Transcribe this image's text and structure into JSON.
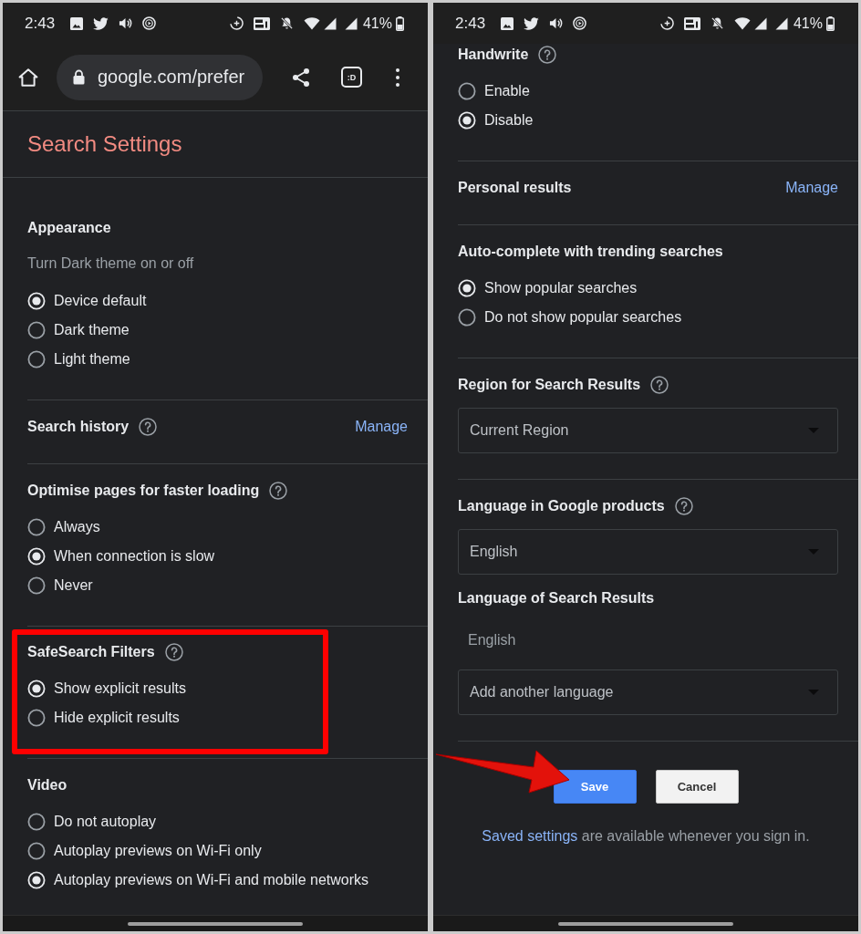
{
  "panels": [
    {
      "status_bar": {
        "time": "2:43",
        "battery": "41%"
      },
      "toolbar": {
        "url": "google.com/prefer",
        "tab_switcher": ":D"
      },
      "title": "Search Settings",
      "sections": [
        {
          "highlighted": false,
          "rows": [
            {
              "kind": "heading",
              "text": "Appearance",
              "help": false
            },
            {
              "kind": "note",
              "text": "Turn Dark theme on or off"
            },
            {
              "kind": "radio",
              "label": "Device default",
              "selected": true
            },
            {
              "kind": "radio",
              "label": "Dark theme",
              "selected": false
            },
            {
              "kind": "radio",
              "label": "Light theme",
              "selected": false
            }
          ]
        },
        {
          "highlighted": false,
          "rows": [
            {
              "kind": "heading",
              "text": "Search history",
              "help": true,
              "link": "Manage"
            }
          ]
        },
        {
          "highlighted": false,
          "rows": [
            {
              "kind": "heading",
              "text": "Optimise pages for faster loading",
              "help": true
            },
            {
              "kind": "radio",
              "label": "Always",
              "selected": false
            },
            {
              "kind": "radio",
              "label": "When connection is slow",
              "selected": true
            },
            {
              "kind": "radio",
              "label": "Never",
              "selected": false
            }
          ]
        },
        {
          "highlighted": true,
          "rows": [
            {
              "kind": "heading",
              "text": "SafeSearch Filters",
              "help": true
            },
            {
              "kind": "radio",
              "label": "Show explicit results",
              "selected": true
            },
            {
              "kind": "radio",
              "label": "Hide explicit results",
              "selected": false
            }
          ]
        },
        {
          "highlighted": false,
          "rows": [
            {
              "kind": "heading",
              "text": "Video",
              "help": false
            },
            {
              "kind": "radio",
              "label": "Do not autoplay",
              "selected": false
            },
            {
              "kind": "radio",
              "label": "Autoplay previews on Wi-Fi only",
              "selected": false
            },
            {
              "kind": "radio",
              "label": "Autoplay previews on Wi-Fi and mobile networks",
              "selected": true
            }
          ]
        }
      ]
    },
    {
      "status_bar": {
        "time": "2:43",
        "battery": "41%"
      },
      "sections": [
        {
          "highlighted": false,
          "rows": [
            {
              "kind": "heading",
              "text": "Handwrite",
              "help": true
            },
            {
              "kind": "radio",
              "label": "Enable",
              "selected": false
            },
            {
              "kind": "radio",
              "label": "Disable",
              "selected": true
            }
          ]
        },
        {
          "highlighted": false,
          "rows": [
            {
              "kind": "heading",
              "text": "Personal results",
              "help": false,
              "link": "Manage"
            }
          ]
        },
        {
          "highlighted": false,
          "rows": [
            {
              "kind": "heading",
              "text": "Auto-complete with trending searches",
              "help": false
            },
            {
              "kind": "radio",
              "label": "Show popular searches",
              "selected": true
            },
            {
              "kind": "radio",
              "label": "Do not show popular searches",
              "selected": false
            }
          ]
        },
        {
          "highlighted": false,
          "rows": [
            {
              "kind": "heading",
              "text": "Region for Search Results",
              "help": true
            },
            {
              "kind": "select",
              "value": "Current Region"
            }
          ]
        },
        {
          "highlighted": false,
          "rows": [
            {
              "kind": "heading",
              "text": "Language in Google products",
              "help": true
            },
            {
              "kind": "select",
              "value": "English"
            },
            {
              "kind": "heading",
              "text": "Language of Search Results",
              "help": false
            },
            {
              "kind": "value",
              "text": "English"
            },
            {
              "kind": "select",
              "value": "Add another language"
            }
          ]
        }
      ],
      "actions": {
        "buttons": [
          {
            "label": "Save",
            "kind": "primary",
            "arrow": true
          },
          {
            "label": "Cancel",
            "kind": "secondary",
            "arrow": false
          }
        ],
        "note": {
          "link": "Saved settings",
          "text": "are available whenever you sign in."
        }
      }
    }
  ]
}
